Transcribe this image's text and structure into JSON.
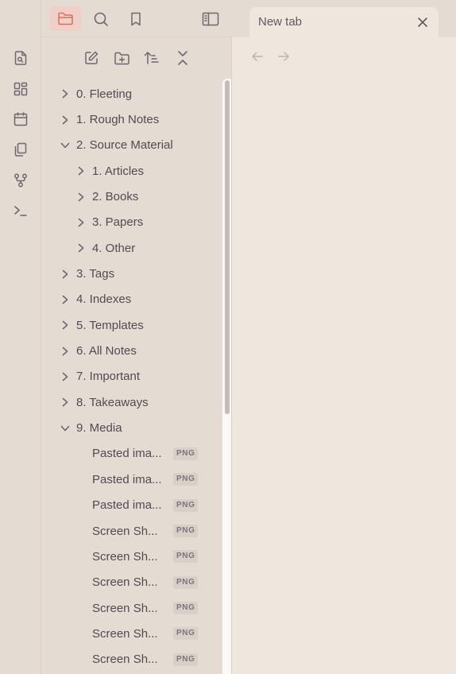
{
  "ribbon": {
    "items": [
      {
        "icon": "file-search-icon"
      },
      {
        "icon": "grid-icon"
      },
      {
        "icon": "calendar-icon"
      },
      {
        "icon": "copy-icon"
      },
      {
        "icon": "graph-icon"
      },
      {
        "icon": "terminal-icon"
      }
    ]
  },
  "sidebar_header": {
    "buttons": [
      {
        "icon": "folder-icon",
        "active": true
      },
      {
        "icon": "search-icon",
        "active": false
      },
      {
        "icon": "bookmark-icon",
        "active": false
      }
    ],
    "toggle_icon": "sidebar-toggle-icon"
  },
  "file_nav": {
    "actions": [
      {
        "icon": "new-note-icon"
      },
      {
        "icon": "new-folder-icon"
      },
      {
        "icon": "sort-icon"
      },
      {
        "icon": "collapse-all-icon"
      }
    ]
  },
  "tree": {
    "folders": [
      {
        "label": "0. Fleeting",
        "expanded": false
      },
      {
        "label": "1. Rough Notes",
        "expanded": false
      },
      {
        "label": "2. Source Material",
        "expanded": true
      },
      {
        "label": "1. Articles",
        "expanded": false
      },
      {
        "label": "2. Books",
        "expanded": false
      },
      {
        "label": "3. Papers",
        "expanded": false
      },
      {
        "label": "4. Other",
        "expanded": false
      },
      {
        "label": "3. Tags",
        "expanded": false
      },
      {
        "label": "4. Indexes",
        "expanded": false
      },
      {
        "label": "5. Templates",
        "expanded": false
      },
      {
        "label": "6. All Notes",
        "expanded": false
      },
      {
        "label": "7. Important",
        "expanded": false
      },
      {
        "label": "8. Takeaways",
        "expanded": false
      },
      {
        "label": "9. Media",
        "expanded": true
      }
    ],
    "files": [
      {
        "label": "Pasted ima...",
        "badge": "PNG"
      },
      {
        "label": "Pasted ima...",
        "badge": "PNG"
      },
      {
        "label": "Pasted ima...",
        "badge": "PNG"
      },
      {
        "label": "Screen Sh...",
        "badge": "PNG"
      },
      {
        "label": "Screen Sh...",
        "badge": "PNG"
      },
      {
        "label": "Screen Sh...",
        "badge": "PNG"
      },
      {
        "label": "Screen Sh...",
        "badge": "PNG"
      },
      {
        "label": "Screen Sh...",
        "badge": "PNG"
      },
      {
        "label": "Screen Sh...",
        "badge": "PNG"
      }
    ]
  },
  "tab": {
    "title": "New tab",
    "close_icon": "close-icon"
  },
  "navigation": {
    "back_icon": "arrow-left-icon",
    "forward_icon": "arrow-right-icon"
  },
  "colors": {
    "accent": "#de6c62",
    "accent_bg": "#efcfc8",
    "sidebar_bg": "#e4dbd2",
    "main_bg": "#efe7de",
    "text": "#514b53"
  }
}
